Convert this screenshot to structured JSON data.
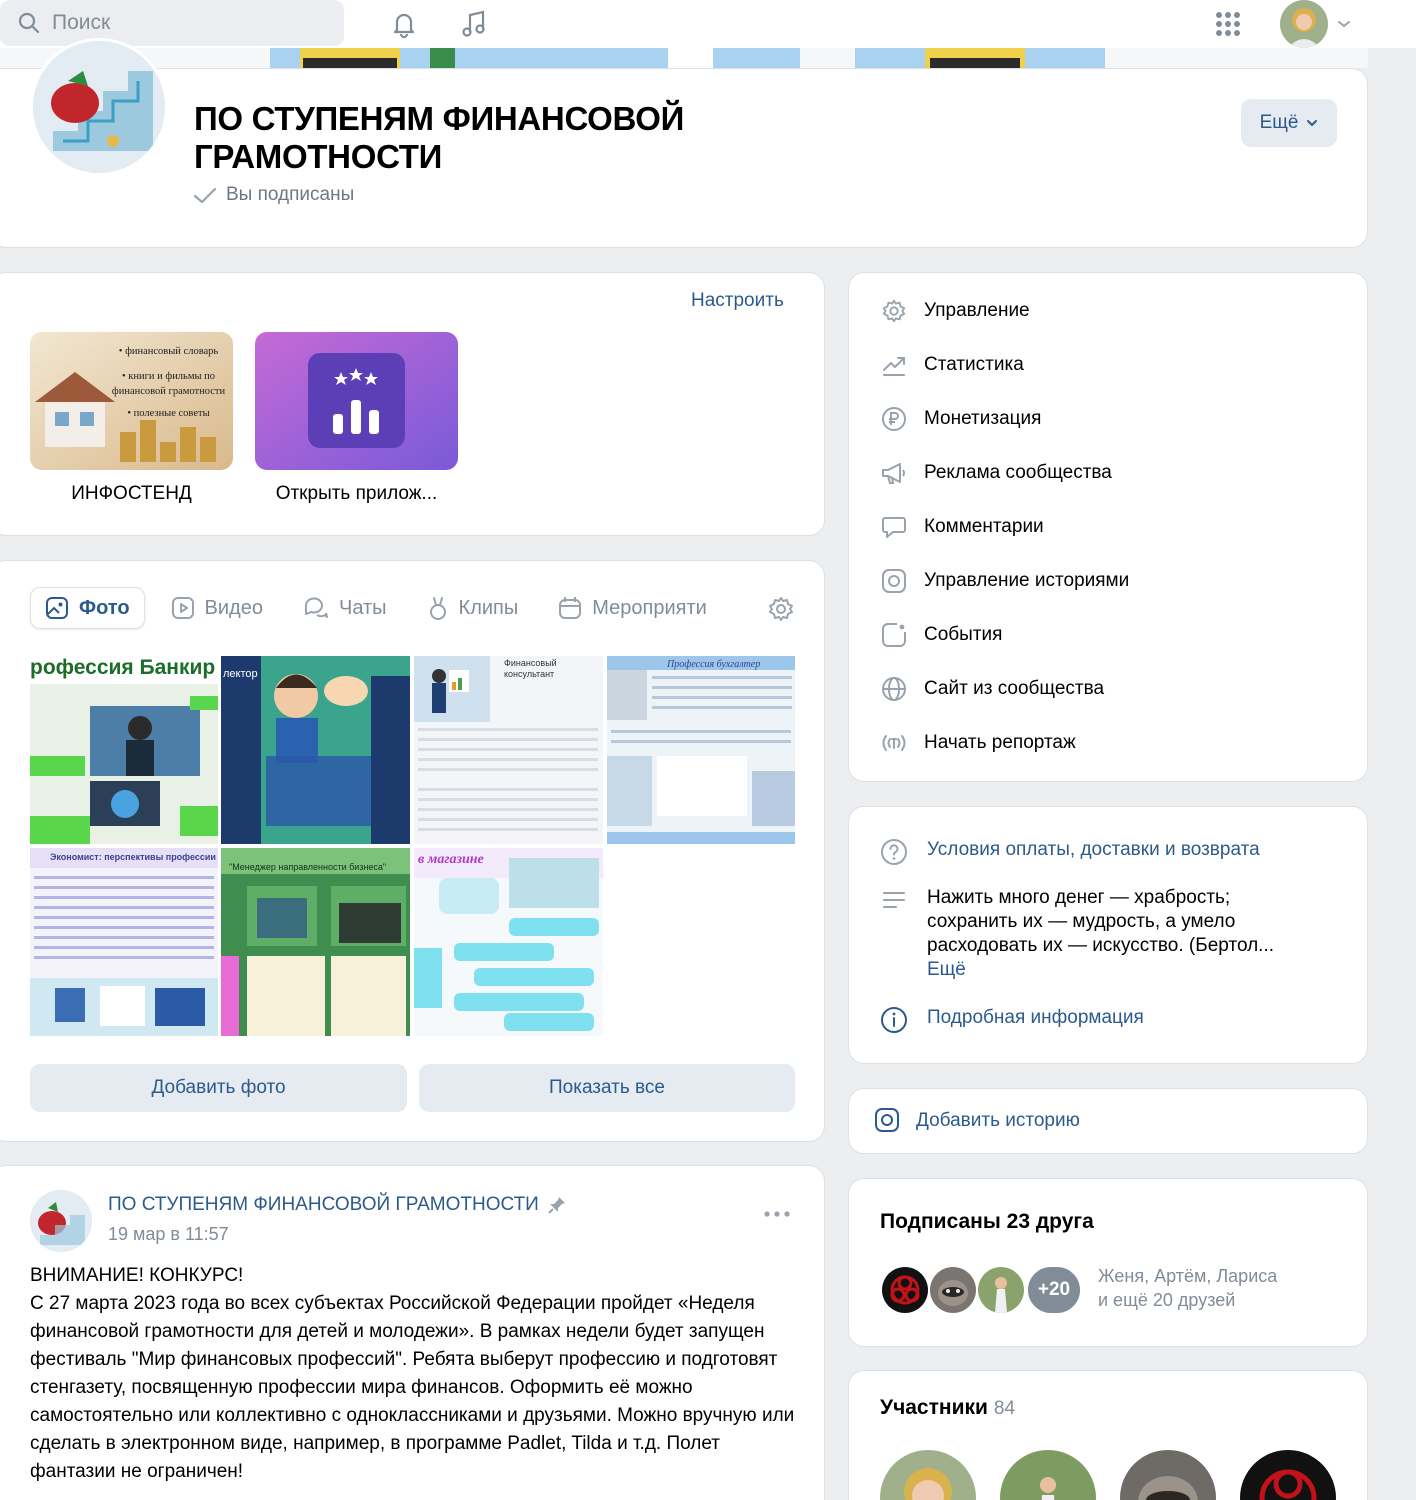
{
  "header": {
    "search_placeholder": "Поиск",
    "icons": [
      "search-icon",
      "bell-icon",
      "music-icon",
      "apps-grid-icon",
      "chevron-down-icon"
    ]
  },
  "group": {
    "title": "ПО СТУПЕНЯМ ФИНАНСОВОЙ ГРАМОТНОСТИ",
    "subscribed": "Вы подписаны",
    "more_label": "Ещё"
  },
  "apps": {
    "setup_label": "Настроить",
    "items": [
      {
        "label": "ИНФОСТЕНД",
        "poster_lines": [
          "• финансовый словарь",
          "• книги и фильмы по",
          "финансовой грамотности",
          "• полезные советы"
        ]
      },
      {
        "label": "Открыть прилож..."
      }
    ]
  },
  "media": {
    "tabs": [
      {
        "label": "Фото",
        "icon": "image-icon"
      },
      {
        "label": "Видео",
        "icon": "video-icon"
      },
      {
        "label": "Чаты",
        "icon": "chats-icon"
      },
      {
        "label": "Клипы",
        "icon": "clips-icon"
      },
      {
        "label": "Мероприяти",
        "icon": "calendar-icon"
      }
    ],
    "photos": [
      {
        "title": "рофессия Банкир",
        "color": "#8fbf8a"
      },
      {
        "title": "лектор",
        "color": "#3aa58c"
      },
      {
        "title": "Финансовый консультант",
        "color": "#cfe0ee"
      },
      {
        "title": "Профессия бухгалтер",
        "color": "#9cc6ea"
      },
      {
        "title": "Экономист: перспективы профессии",
        "color": "#e5e0f5"
      },
      {
        "title": "\"Менеджер направленности бизнеса\"",
        "color": "#7cc27a"
      },
      {
        "title": "в магазине",
        "color": "#c8ecf3"
      }
    ],
    "add_photo": "Добавить фото",
    "show_all": "Показать все"
  },
  "post": {
    "author": "ПО СТУПЕНЯМ ФИНАНСОВОЙ ГРАМОТНОСТИ",
    "date": "19 мар в 11:57",
    "heading": "ВНИМАНИЕ! КОНКУРС!",
    "body": "С 27 марта 2023 года во всех субъектах Российской Федерации пройдет «Неделя финансовой грамотности для детей и молодежи». В рамках недели будет запущен фестиваль \"Мир финансовых профессий\". Ребята выберут профессию и подготовят стенгазету, посвященную профессии мира финансов. Оформить её можно самостоятельно или коллективно с одноклассниками и друзьями. Можно вручную или сделать в электронном виде, например, в программе Padlet, Tilda и т.д. Полет фантазии не ограничен!"
  },
  "admin_menu": [
    {
      "label": "Управление",
      "icon": "gear-icon"
    },
    {
      "label": "Статистика",
      "icon": "stats-icon"
    },
    {
      "label": "Монетизация",
      "icon": "ruble-icon"
    },
    {
      "label": "Реклама сообщества",
      "icon": "megaphone-icon"
    },
    {
      "label": "Комментарии",
      "icon": "comment-icon"
    },
    {
      "label": "Управление историями",
      "icon": "story-icon"
    },
    {
      "label": "События",
      "icon": "event-icon"
    },
    {
      "label": "Сайт из сообщества",
      "icon": "globe-icon"
    },
    {
      "label": "Начать репортаж",
      "icon": "broadcast-icon"
    }
  ],
  "info": {
    "terms": "Условия оплаты, доставки и возврата",
    "description": "Нажить много денег — храбрость; сохранить их — мудрость, а умело расходовать их — искусство. (Бертол...",
    "description_more": "Ещё",
    "details": "Подробная информация"
  },
  "story": {
    "add": "Добавить историю"
  },
  "friends": {
    "title": "Подписаны 23 друга",
    "plus": "+20",
    "names": "Женя, Артём, Лариса",
    "more": "и ещё 20 друзей"
  },
  "members": {
    "title": "Участники",
    "count": "84"
  }
}
